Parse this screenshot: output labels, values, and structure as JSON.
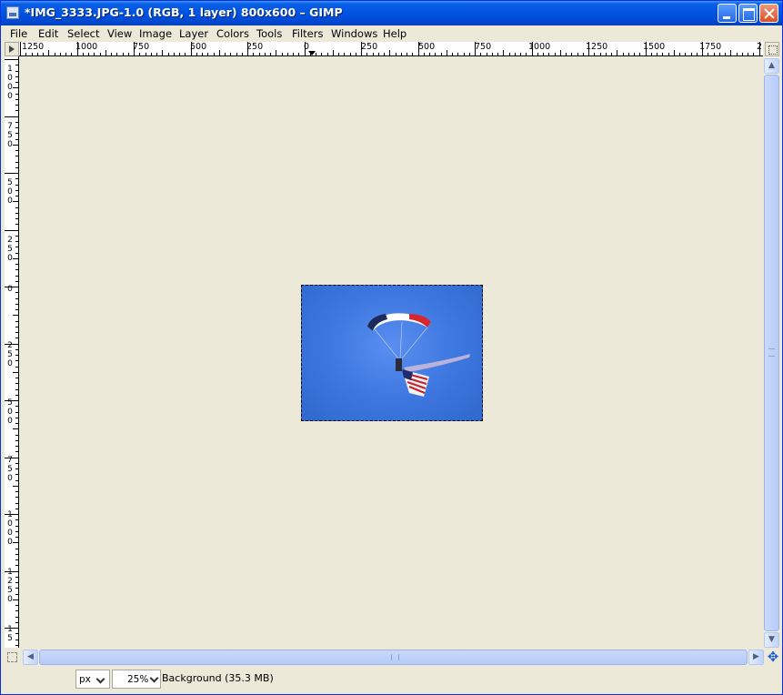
{
  "window": {
    "title": "*IMG_3333.JPG-1.0 (RGB, 1 layer) 800x600 – GIMP",
    "accent_color": "#0054e3"
  },
  "menu": {
    "items": [
      "File",
      "Edit",
      "Select",
      "View",
      "Image",
      "Layer",
      "Colors",
      "Tools",
      "Filters",
      "Windows",
      "Help"
    ]
  },
  "rulers": {
    "horizontal_labels": [
      "1250",
      "1000",
      "750",
      "500",
      "250",
      "0",
      "250",
      "500",
      "750",
      "1000",
      "1250",
      "1500",
      "1750",
      "2"
    ],
    "vertical_labels": [
      "1000",
      "750",
      "500",
      "250",
      "0",
      "250",
      "500",
      "750",
      "1000",
      "1250",
      "15"
    ]
  },
  "canvas": {
    "background_color": "#ece9d8",
    "image_sky_color": "#3d77e0"
  },
  "icons": {
    "ruler_corner": "triangle-right-icon",
    "navigate": "navigate-icon",
    "quick_mask": "quick-mask-icon",
    "move": "move-arrows-icon"
  },
  "status": {
    "unit": "px",
    "zoom": "25%",
    "layer_info": "Background (35.3 MB)"
  }
}
